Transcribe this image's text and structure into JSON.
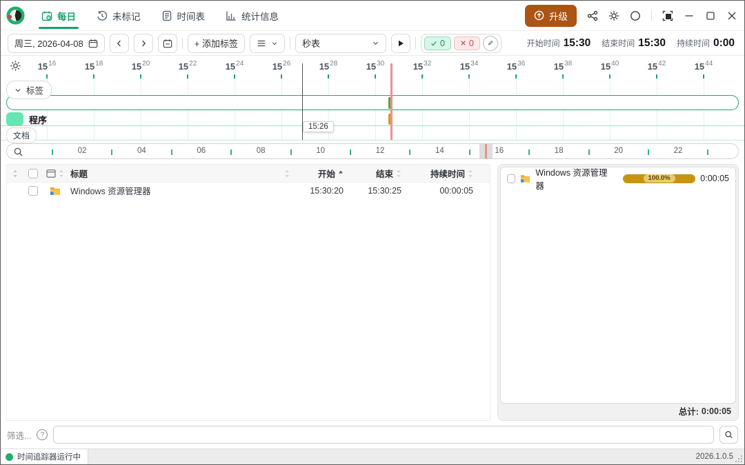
{
  "app": {
    "status_text": "时间追踪器运行中",
    "version": "2026.1.0.5",
    "accent_green": "#17a06b",
    "now_line_red": "#ef9090"
  },
  "titlebar": {
    "tabs": [
      {
        "label": "每日",
        "icon": "calendar-icon",
        "active": true
      },
      {
        "label": "未标记",
        "icon": "history-icon",
        "active": false
      },
      {
        "label": "时间表",
        "icon": "sheet-icon",
        "active": false
      },
      {
        "label": "统计信息",
        "icon": "chart-icon",
        "active": false
      }
    ],
    "upgrade_label": "升级"
  },
  "toolbar": {
    "date_value": "周三, 2026-04-08",
    "add_label_button": "+ 添加标签",
    "tracker_select_value": "秒表",
    "ok_count": "0",
    "fail_count": "0",
    "start_label": "开始时间",
    "start_value": "15:30",
    "end_label": "结束时间",
    "end_value": "15:30",
    "duration_label": "持续时间",
    "duration_value": "0:00"
  },
  "timeline": {
    "ticks": [
      {
        "h": "15",
        "m": "16"
      },
      {
        "h": "15",
        "m": "18"
      },
      {
        "h": "15",
        "m": "20"
      },
      {
        "h": "15",
        "m": "22"
      },
      {
        "h": "15",
        "m": "24"
      },
      {
        "h": "15",
        "m": "26"
      },
      {
        "h": "15",
        "m": "28"
      },
      {
        "h": "15",
        "m": "30"
      },
      {
        "h": "15",
        "m": "32"
      },
      {
        "h": "15",
        "m": "34"
      },
      {
        "h": "15",
        "m": "36"
      },
      {
        "h": "15",
        "m": "38"
      },
      {
        "h": "15",
        "m": "40"
      },
      {
        "h": "15",
        "m": "42"
      },
      {
        "h": "15",
        "m": "44"
      }
    ],
    "rows": {
      "labels": "标签",
      "apps": "程序",
      "logs": "文档"
    },
    "cursor_tooltip": "15:26",
    "events": [
      {
        "track": "标签",
        "time": "15:30",
        "color": "#52a447"
      },
      {
        "track": "程序",
        "time": "15:30",
        "color": "#d09c20"
      }
    ]
  },
  "minimap": {
    "hours": [
      "02",
      "04",
      "06",
      "08",
      "10",
      "12",
      "14",
      "16",
      "18",
      "20",
      "22"
    ]
  },
  "table": {
    "columns": {
      "title": "标题",
      "start": "开始",
      "end": "结束",
      "duration": "持续时间"
    },
    "rows": [
      {
        "title": "Windows 资源管理器",
        "start": "15:30:20",
        "end": "15:30:25",
        "duration": "00:00:05"
      }
    ]
  },
  "summary": {
    "rows": [
      {
        "title": "Windows 资源管理器",
        "percent": "100.0%",
        "duration": "0:00:05"
      }
    ],
    "total_label": "总计:",
    "total_value": "0:00:05"
  },
  "filter": {
    "label": "筛选...",
    "input_value": ""
  }
}
